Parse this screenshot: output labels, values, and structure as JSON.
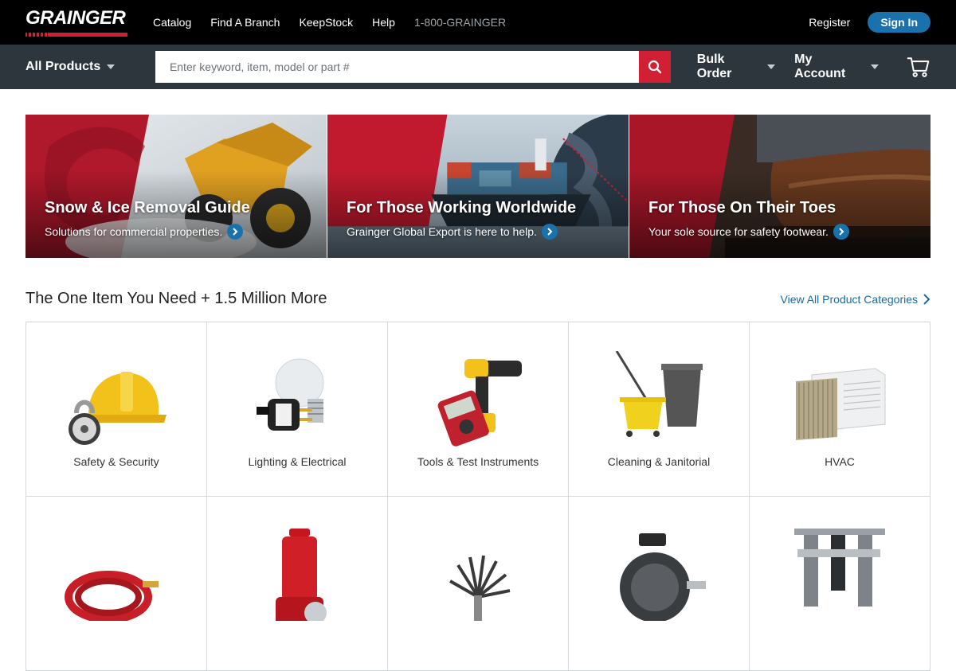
{
  "brand": {
    "name": "GRAINGER",
    "red": "#d11f34",
    "blue": "#1a72ad"
  },
  "topnav": {
    "items": [
      "Catalog",
      "Find A Branch",
      "KeepStock",
      "Help"
    ],
    "phone": "1-800-GRAINGER",
    "register": "Register",
    "signin": "Sign In"
  },
  "searchbar": {
    "all_products": "All Products",
    "placeholder": "Enter keyword, item, model or part #",
    "bulk_order": "Bulk Order",
    "my_account": "My Account"
  },
  "banners": [
    {
      "title": "Snow & Ice Removal Guide",
      "sub": "Solutions for commercial properties."
    },
    {
      "title": "For Those Working Worldwide",
      "sub": "Grainger Global Export is here to help."
    },
    {
      "title": "For Those On Their Toes",
      "sub": "Your sole source for safety footwear."
    }
  ],
  "section": {
    "title": "The One Item You Need + 1.5 Million More",
    "view_all": "View All Product Categories"
  },
  "categories": [
    {
      "label": "Safety & Security",
      "icon": "hard-hat-padlock-icon"
    },
    {
      "label": "Lighting & Electrical",
      "icon": "bulb-plug-icon"
    },
    {
      "label": "Tools & Test Instruments",
      "icon": "drill-multimeter-icon"
    },
    {
      "label": "Cleaning & Janitorial",
      "icon": "mop-bucket-icon"
    },
    {
      "label": "HVAC",
      "icon": "air-conditioner-icon"
    },
    {
      "label": "",
      "icon": "hose-icon"
    },
    {
      "label": "",
      "icon": "pump-icon"
    },
    {
      "label": "",
      "icon": "brush-icon"
    },
    {
      "label": "",
      "icon": "motor-icon"
    },
    {
      "label": "",
      "icon": "filter-regulator-icon"
    }
  ]
}
